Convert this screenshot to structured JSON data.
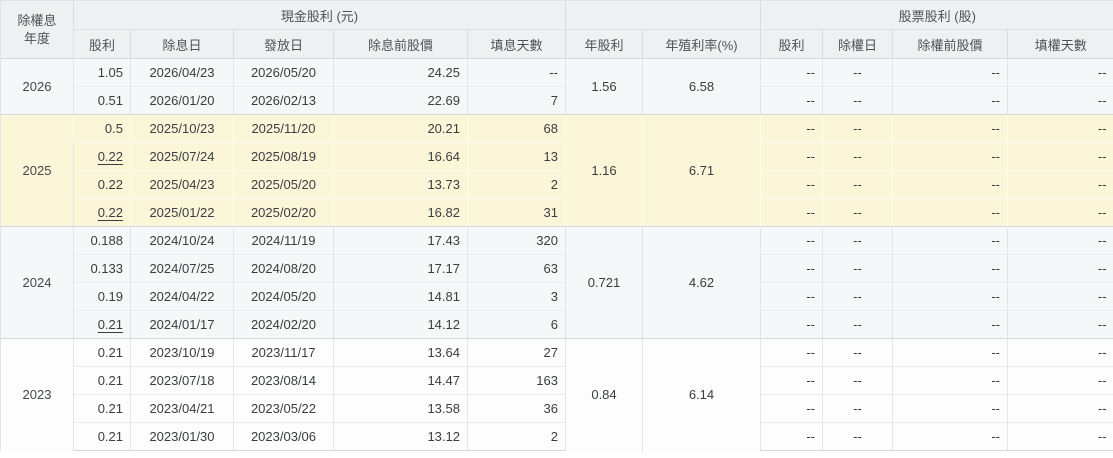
{
  "table": {
    "header": {
      "year_line1": "除權息",
      "year_line2": "年度",
      "group_cash": "現金股利 (元)",
      "group_stock": "股票股利 (股)",
      "cash_cols": [
        "股利",
        "除息日",
        "發放日",
        "除息前股價",
        "填息天數"
      ],
      "annual_cols": [
        "年股利",
        "年殖利率(%)"
      ],
      "stock_cols": [
        "股利",
        "除權日",
        "除權前股價",
        "填權天數"
      ]
    },
    "empty_value": "--",
    "groups": [
      {
        "year": "2026",
        "shade": "gray",
        "highlight": false,
        "annual_dividend": "1.56",
        "annual_yield": "6.58",
        "rows": [
          {
            "dividend": "1.05",
            "underline": false,
            "ex_date": "2026/04/23",
            "pay_date": "2026/05/20",
            "price_before": "24.25",
            "fill_days": "--",
            "stock_dividend": "--",
            "stock_ex_date": "--",
            "stock_price_before": "--",
            "stock_fill_days": "--"
          },
          {
            "dividend": "0.51",
            "underline": false,
            "ex_date": "2026/01/20",
            "pay_date": "2026/02/13",
            "price_before": "22.69",
            "fill_days": "7",
            "stock_dividend": "--",
            "stock_ex_date": "--",
            "stock_price_before": "--",
            "stock_fill_days": "--"
          }
        ]
      },
      {
        "year": "2025",
        "shade": "white",
        "highlight": true,
        "annual_dividend": "1.16",
        "annual_yield": "6.71",
        "rows": [
          {
            "dividend": "0.5",
            "underline": false,
            "ex_date": "2025/10/23",
            "pay_date": "2025/11/20",
            "price_before": "20.21",
            "fill_days": "68",
            "stock_dividend": "--",
            "stock_ex_date": "--",
            "stock_price_before": "--",
            "stock_fill_days": "--"
          },
          {
            "dividend": "0.22",
            "underline": true,
            "ex_date": "2025/07/24",
            "pay_date": "2025/08/19",
            "price_before": "16.64",
            "fill_days": "13",
            "stock_dividend": "--",
            "stock_ex_date": "--",
            "stock_price_before": "--",
            "stock_fill_days": "--"
          },
          {
            "dividend": "0.22",
            "underline": false,
            "ex_date": "2025/04/23",
            "pay_date": "2025/05/20",
            "price_before": "13.73",
            "fill_days": "2",
            "stock_dividend": "--",
            "stock_ex_date": "--",
            "stock_price_before": "--",
            "stock_fill_days": "--"
          },
          {
            "dividend": "0.22",
            "underline": true,
            "ex_date": "2025/01/22",
            "pay_date": "2025/02/20",
            "price_before": "16.82",
            "fill_days": "31",
            "stock_dividend": "--",
            "stock_ex_date": "--",
            "stock_price_before": "--",
            "stock_fill_days": "--"
          }
        ]
      },
      {
        "year": "2024",
        "shade": "gray",
        "highlight": false,
        "annual_dividend": "0.721",
        "annual_yield": "4.62",
        "rows": [
          {
            "dividend": "0.188",
            "underline": false,
            "ex_date": "2024/10/24",
            "pay_date": "2024/11/19",
            "price_before": "17.43",
            "fill_days": "320",
            "stock_dividend": "--",
            "stock_ex_date": "--",
            "stock_price_before": "--",
            "stock_fill_days": "--"
          },
          {
            "dividend": "0.133",
            "underline": false,
            "ex_date": "2024/07/25",
            "pay_date": "2024/08/20",
            "price_before": "17.17",
            "fill_days": "63",
            "stock_dividend": "--",
            "stock_ex_date": "--",
            "stock_price_before": "--",
            "stock_fill_days": "--"
          },
          {
            "dividend": "0.19",
            "underline": false,
            "ex_date": "2024/04/22",
            "pay_date": "2024/05/20",
            "price_before": "14.81",
            "fill_days": "3",
            "stock_dividend": "--",
            "stock_ex_date": "--",
            "stock_price_before": "--",
            "stock_fill_days": "--"
          },
          {
            "dividend": "0.21",
            "underline": true,
            "ex_date": "2024/01/17",
            "pay_date": "2024/02/20",
            "price_before": "14.12",
            "fill_days": "6",
            "stock_dividend": "--",
            "stock_ex_date": "--",
            "stock_price_before": "--",
            "stock_fill_days": "--"
          }
        ]
      },
      {
        "year": "2023",
        "shade": "white",
        "highlight": false,
        "annual_dividend": "0.84",
        "annual_yield": "6.14",
        "rows": [
          {
            "dividend": "0.21",
            "underline": false,
            "ex_date": "2023/10/19",
            "pay_date": "2023/11/17",
            "price_before": "13.64",
            "fill_days": "27",
            "stock_dividend": "--",
            "stock_ex_date": "--",
            "stock_price_before": "--",
            "stock_fill_days": "--"
          },
          {
            "dividend": "0.21",
            "underline": false,
            "ex_date": "2023/07/18",
            "pay_date": "2023/08/14",
            "price_before": "14.47",
            "fill_days": "163",
            "stock_dividend": "--",
            "stock_ex_date": "--",
            "stock_price_before": "--",
            "stock_fill_days": "--"
          },
          {
            "dividend": "0.21",
            "underline": false,
            "ex_date": "2023/04/21",
            "pay_date": "2023/05/22",
            "price_before": "13.58",
            "fill_days": "36",
            "stock_dividend": "--",
            "stock_ex_date": "--",
            "stock_price_before": "--",
            "stock_fill_days": "--"
          },
          {
            "dividend": "0.21",
            "underline": false,
            "ex_date": "2023/01/30",
            "pay_date": "2023/03/06",
            "price_before": "13.12",
            "fill_days": "2",
            "stock_dividend": "--",
            "stock_ex_date": "--",
            "stock_price_before": "--",
            "stock_fill_days": "--"
          }
        ]
      }
    ]
  },
  "colors": {
    "highlight_row_bg": "#fcf6d9",
    "gray_row_bg": "#f6f7f8",
    "white_row_bg": "#fdfdfe",
    "header_bg": "#eef0f2",
    "group_border": "#d5d9dd",
    "inner_border": "#e8eaed",
    "text": "#3a3d40"
  }
}
